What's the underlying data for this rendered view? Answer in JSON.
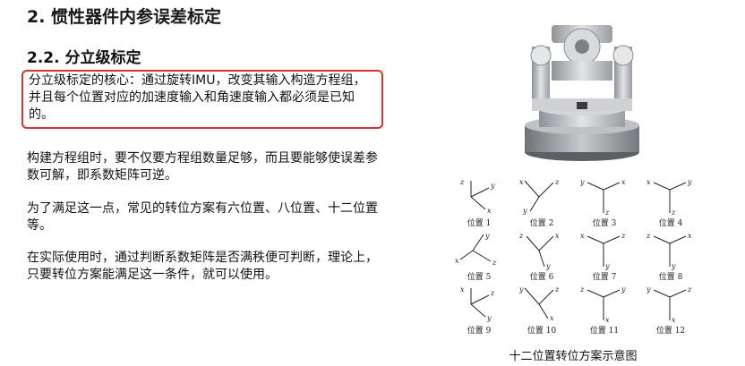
{
  "heading": "2. 惯性器件内参误差标定",
  "subheading": "2.2. 分立级标定",
  "highlight_text": "分立级标定的核心：通过旋转IMU，改变其输入构造方程组，并且每个位置对应的加速度输入和角速度输入都必须是已知的。",
  "paragraphs": [
    "构建方程组时，要不仅要方程组数量足够，而且要能够使误差参数可解，即系数矩阵可逆。",
    "为了满足这一点，常见的转位方案有六位置、八位置、十二位置等。",
    "在实际使用时，通过判断系数矩阵是否满秩便可判断，理论上，只要转位方案能满足这一条件，就可以使用。"
  ],
  "positions": [
    "位置 1",
    "位置 2",
    "位置 3",
    "位置 4",
    "位置 5",
    "位置 6",
    "位置 7",
    "位置 8",
    "位置 9",
    "位置 10",
    "位置 11",
    "位置 12"
  ],
  "caption": "十二位置转位方案示意图",
  "colors": {
    "highlight_border": "#d9332b"
  }
}
